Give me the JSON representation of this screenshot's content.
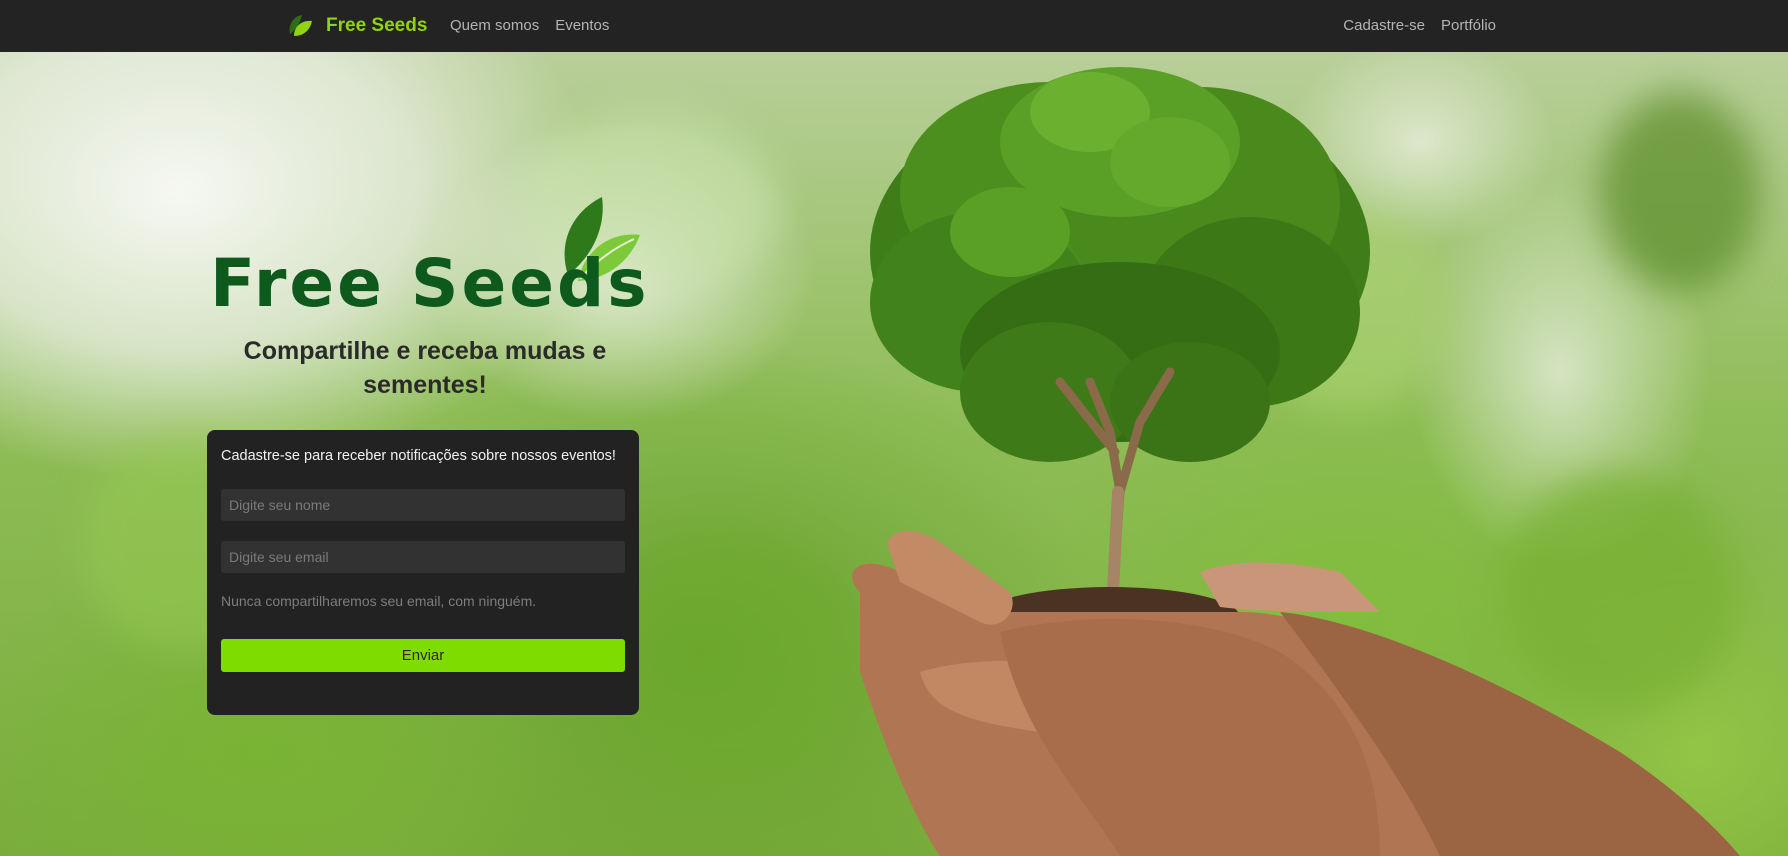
{
  "navbar": {
    "brand_name": "Free Seeds",
    "brand_icon": "leaf-icon",
    "left_links": [
      {
        "label": "Quem somos"
      },
      {
        "label": "Eventos"
      }
    ],
    "right_links": [
      {
        "label": "Cadastre-se"
      },
      {
        "label": "Portfólio"
      }
    ]
  },
  "hero": {
    "logo_text": "Free Seeds",
    "logo_icon": "leaf-icon",
    "tagline": "Compartilhe e receba mudas e sementes!",
    "image": "hands-holding-tree-image"
  },
  "signup": {
    "title": "Cadastre-se para receber notificações sobre nossos eventos!",
    "name_placeholder": "Digite seu nome",
    "email_placeholder": "Digite seu email",
    "hint": "Nunca compartilharemos seu email, com ninguém.",
    "submit_label": "Enviar"
  },
  "colors": {
    "navbar_bg": "#232323",
    "brand_green": "#8fd311",
    "logo_green": "#0d5a1c",
    "button_green": "#7fdc00",
    "card_bg": "#222222"
  }
}
